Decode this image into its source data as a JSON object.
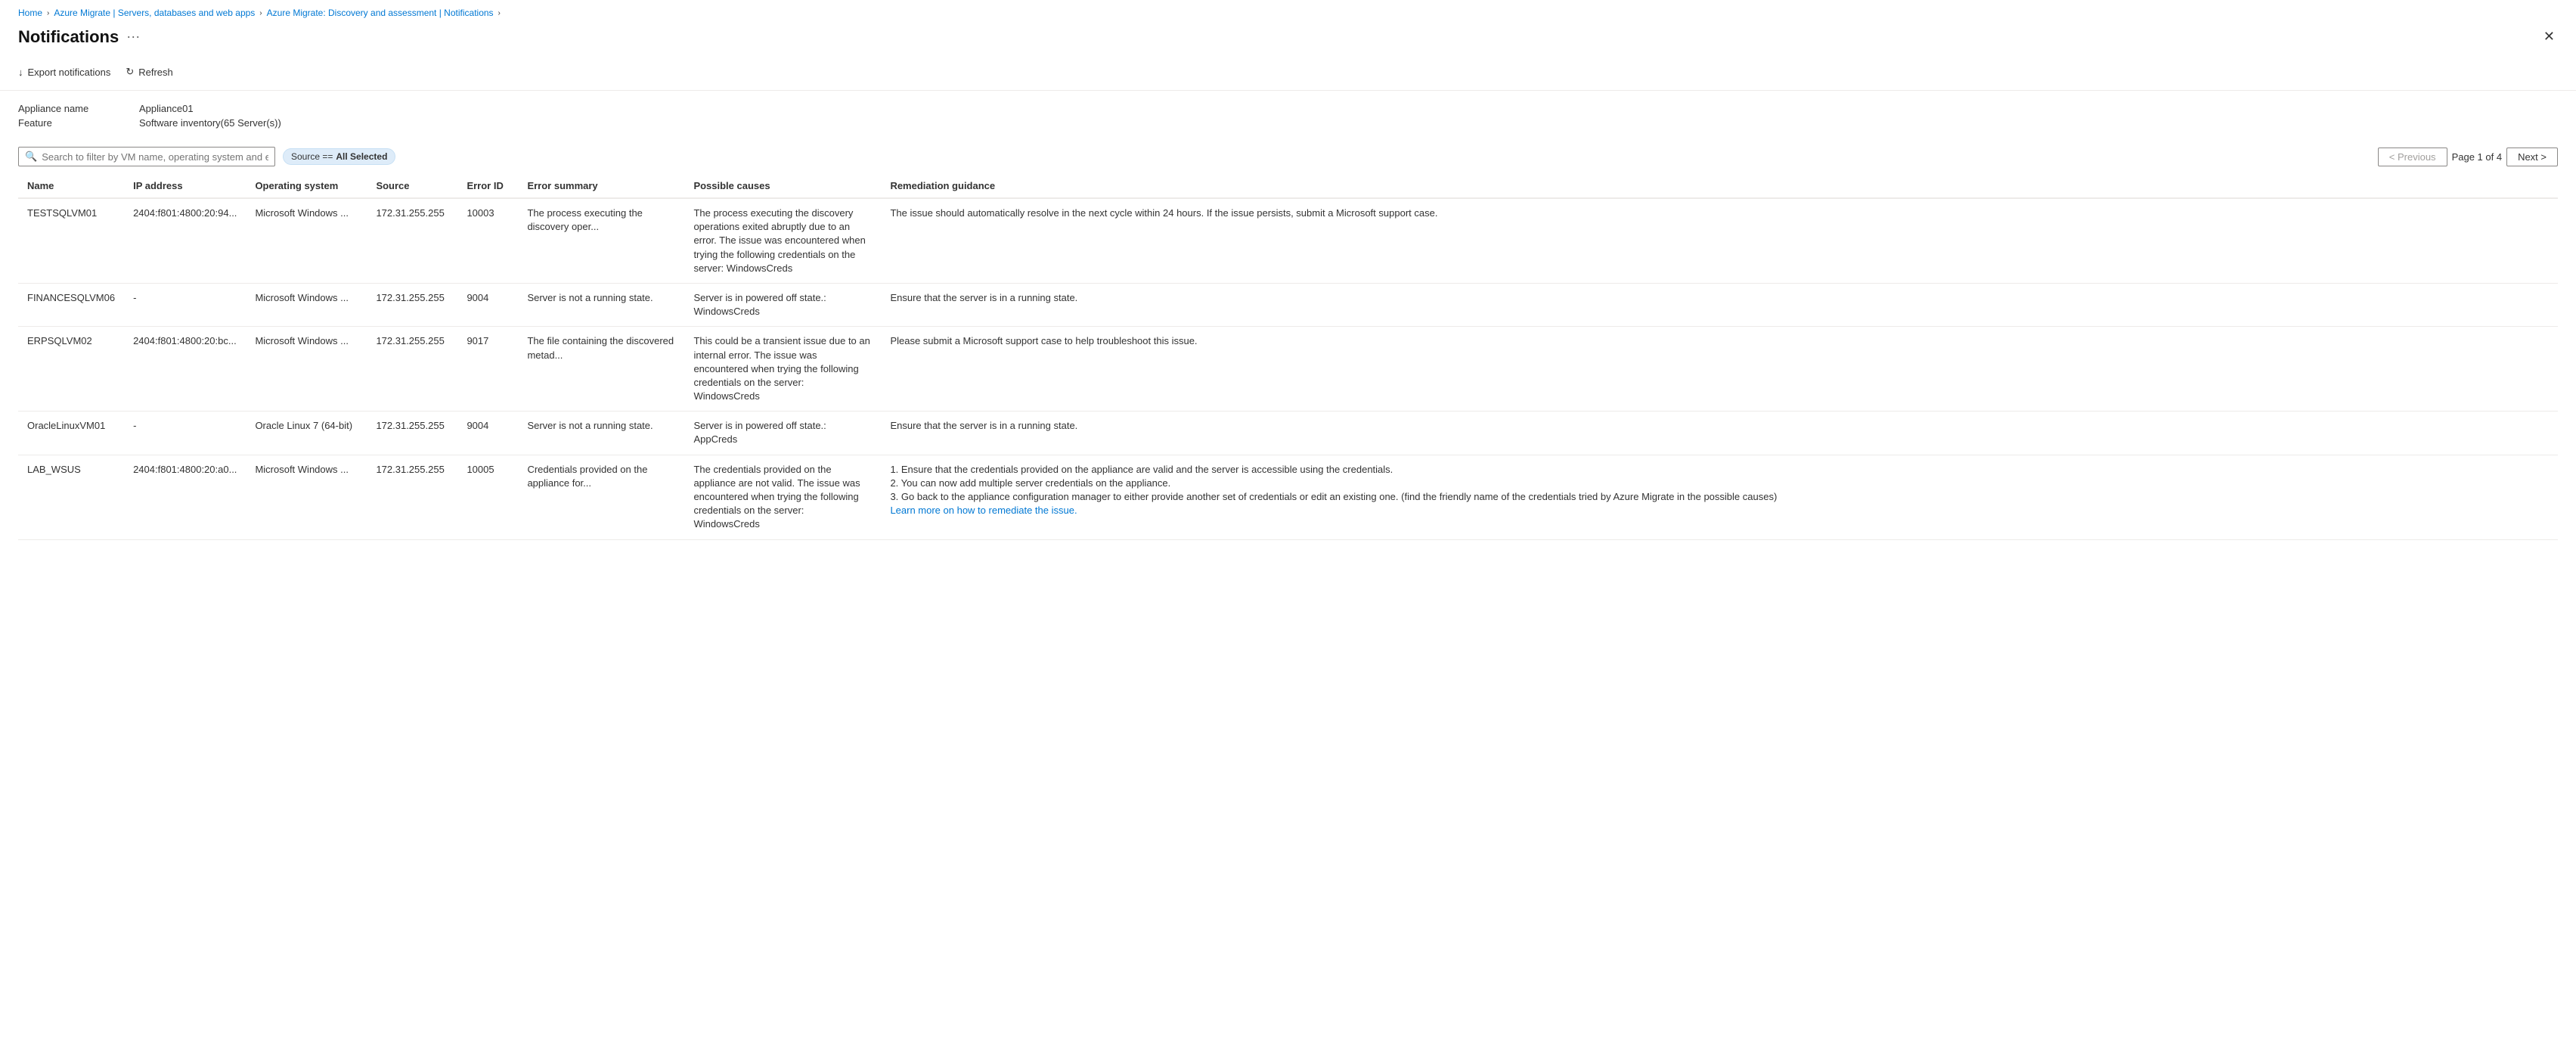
{
  "breadcrumb": {
    "items": [
      {
        "label": "Home",
        "active": true
      },
      {
        "label": "Azure Migrate | Servers, databases and web apps",
        "active": true
      },
      {
        "label": "Azure Migrate: Discovery and assessment | Notifications",
        "active": true
      }
    ]
  },
  "page": {
    "title": "Notifications",
    "more_label": "···",
    "close_label": "✕"
  },
  "toolbar": {
    "export_label": "Export notifications",
    "refresh_label": "Refresh"
  },
  "meta": {
    "appliance_label": "Appliance name",
    "appliance_value": "Appliance01",
    "feature_label": "Feature",
    "feature_value": "Software inventory(65 Server(s))"
  },
  "filter": {
    "search_placeholder": "Search to filter by VM name, operating system and error ID",
    "badge_prefix": "Source ==",
    "badge_value": "All Selected"
  },
  "pagination": {
    "previous_label": "< Previous",
    "next_label": "Next >",
    "page_info": "Page 1 of 4"
  },
  "table": {
    "columns": [
      "Name",
      "IP address",
      "Operating system",
      "Source",
      "Error ID",
      "Error summary",
      "Possible causes",
      "Remediation guidance"
    ],
    "rows": [
      {
        "name": "TESTSQLVM01",
        "ip": "2404:f801:4800:20:94...",
        "os": "Microsoft Windows ...",
        "source": "172.31.255.255",
        "error_id": "10003",
        "error_summary": "The process executing the discovery oper...",
        "possible_causes": "The process executing the discovery operations exited abruptly due to an error. The issue was encountered when trying the following credentials on the server: WindowsCreds",
        "remediation": "The issue should automatically resolve in the next cycle within 24 hours. If the issue persists, submit a Microsoft support case.",
        "learn_more": null
      },
      {
        "name": "FINANCESQLVM06",
        "ip": "-",
        "os": "Microsoft Windows ...",
        "source": "172.31.255.255",
        "error_id": "9004",
        "error_summary": "Server is not a running state.",
        "possible_causes": "Server is in powered off state.: WindowsCreds",
        "remediation": "Ensure that the server is in a running state.",
        "learn_more": null
      },
      {
        "name": "ERPSQLVM02",
        "ip": "2404:f801:4800:20:bc...",
        "os": "Microsoft Windows ...",
        "source": "172.31.255.255",
        "error_id": "9017",
        "error_summary": "The file containing the discovered metad...",
        "possible_causes": "This could be a transient issue due to an internal error. The issue was encountered when trying the following credentials on the server: WindowsCreds",
        "remediation": "Please submit a Microsoft support case to help troubleshoot this issue.",
        "learn_more": null
      },
      {
        "name": "OracleLinuxVM01",
        "ip": "-",
        "os": "Oracle Linux 7 (64-bit)",
        "source": "172.31.255.255",
        "error_id": "9004",
        "error_summary": "Server is not a running state.",
        "possible_causes": "Server is in powered off state.: AppCreds",
        "remediation": "Ensure that the server is in a running state.",
        "learn_more": null
      },
      {
        "name": "LAB_WSUS",
        "ip": "2404:f801:4800:20:a0...",
        "os": "Microsoft Windows ...",
        "source": "172.31.255.255",
        "error_id": "10005",
        "error_summary": "Credentials provided on the appliance for...",
        "possible_causes": "The credentials provided on the appliance are not valid. The issue was encountered when trying the following credentials on the server: WindowsCreds",
        "remediation": "1. Ensure that the credentials provided on the appliance are valid and the server is accessible using the credentials.\n2. You can now add multiple server credentials on the appliance.\n3. Go back to the appliance configuration manager to either provide another set of credentials or edit an existing one. (find the friendly name of the credentials tried by Azure Migrate in the possible causes)",
        "learn_more": "Learn more on how to remediate the issue."
      }
    ]
  }
}
